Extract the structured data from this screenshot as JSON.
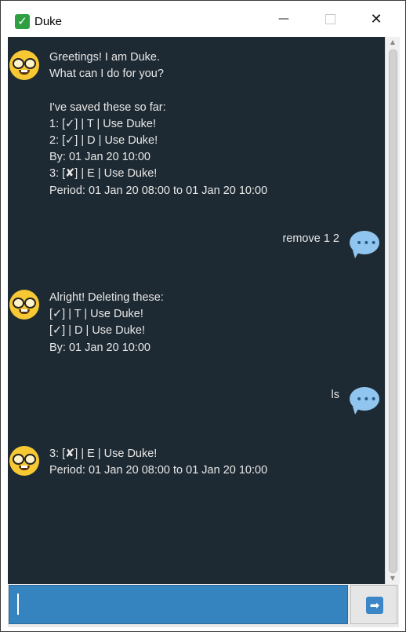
{
  "window": {
    "title": "Duke",
    "app_icon": "check-mark-icon",
    "controls": {
      "minimize": "—",
      "close": "✕"
    }
  },
  "chat": {
    "messages": [
      {
        "sender": "duke",
        "avatar": "nerd-face-icon",
        "text": "Greetings! I am Duke.\nWhat can I do for you?\n\nI've saved these so far:\n1: [✓] | T | Use Duke!\n2: [✓] | D | Use Duke!\nBy: 01 Jan 20 10:00\n3: [✘] | E | Use Duke!\nPeriod: 01 Jan 20 08:00 to 01 Jan 20 10:00"
      },
      {
        "sender": "user",
        "avatar": "speech-bubble-icon",
        "text": "remove 1 2"
      },
      {
        "sender": "duke",
        "avatar": "nerd-face-icon",
        "text": "Alright! Deleting these:\n[✓] | T | Use Duke!\n[✓] | D | Use Duke!\nBy: 01 Jan 20 10:00"
      },
      {
        "sender": "user",
        "avatar": "speech-bubble-icon",
        "text": "ls"
      },
      {
        "sender": "duke",
        "avatar": "nerd-face-icon",
        "text": "3: [✘] | E | Use Duke!\nPeriod: 01 Jan 20 08:00 to 01 Jan 20 10:00"
      }
    ]
  },
  "input": {
    "value": "",
    "placeholder": ""
  },
  "send_button": {
    "icon": "arrow-right-icon"
  },
  "colors": {
    "chat_background": "#1e2a33",
    "input_background": "#3584bf",
    "user_bubble": "#8fc5ee",
    "duke_avatar": "#f6c834"
  }
}
